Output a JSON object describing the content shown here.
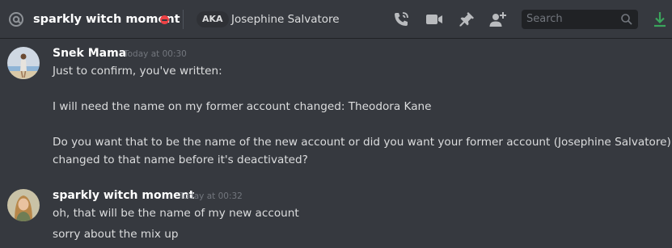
{
  "header": {
    "dm_name": "sparkly witch moment",
    "aka_label": "AKA",
    "aka_name": "Josephine Salvatore",
    "search_placeholder": "Search",
    "icons": [
      "at-icon",
      "call-icon",
      "video-icon",
      "pin-icon",
      "add-friend-icon",
      "search-icon",
      "download-icon"
    ]
  },
  "colors": {
    "background": "#36393f",
    "dnd_status": "#ed4245",
    "download_accent": "#3ba55c"
  },
  "messages": [
    {
      "author": "Snek Mama",
      "timestamp": "Today at 00:30",
      "lines": [
        "Just to confirm, you've written:",
        "I will need the name on my former account changed: Theodora Kane",
        "Do you want that to be the name of the new account or did you want your former account (Josephine Salvatore)",
        "changed to that name before it's deactivated?"
      ]
    },
    {
      "author": "sparkly witch moment",
      "timestamp": "Today at 00:32",
      "lines": [
        "oh, that will be the name of my new account",
        "sorry about the mix up"
      ]
    }
  ]
}
